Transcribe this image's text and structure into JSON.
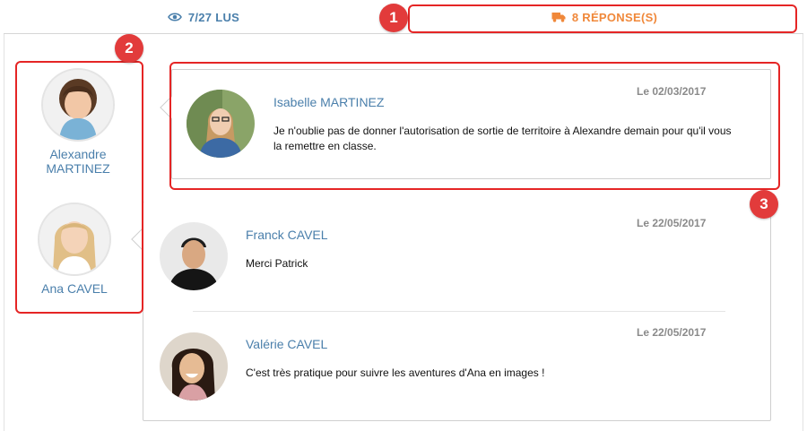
{
  "tabs": {
    "read": {
      "label": "7/27 LUS",
      "icon": "eye-icon"
    },
    "replies": {
      "label": "8 RÉPONSE(S)",
      "icon": "truck-icon"
    }
  },
  "children": [
    {
      "name": "Alexandre MARTINEZ"
    },
    {
      "name": "Ana CAVEL"
    }
  ],
  "threads": [
    {
      "messages": [
        {
          "author": "Isabelle MARTINEZ",
          "date": "Le 02/03/2017",
          "text": "Je n'oublie pas de donner l'autorisation de sortie de territoire à Alexandre demain pour qu'il vous la remettre en classe."
        }
      ]
    },
    {
      "messages": [
        {
          "author": "Franck CAVEL",
          "date": "Le 22/05/2017",
          "text": "Merci Patrick"
        },
        {
          "author": "Valérie CAVEL",
          "date": "Le 22/05/2017",
          "text": "C'est très pratique pour suivre les aventures d'Ana en images !"
        }
      ]
    }
  ],
  "annotations": {
    "badge1": "1",
    "badge2": "2",
    "badge3": "3"
  },
  "colors": {
    "link": "#4a7fab",
    "accent": "#f0883a",
    "annotation": "#e52525"
  }
}
